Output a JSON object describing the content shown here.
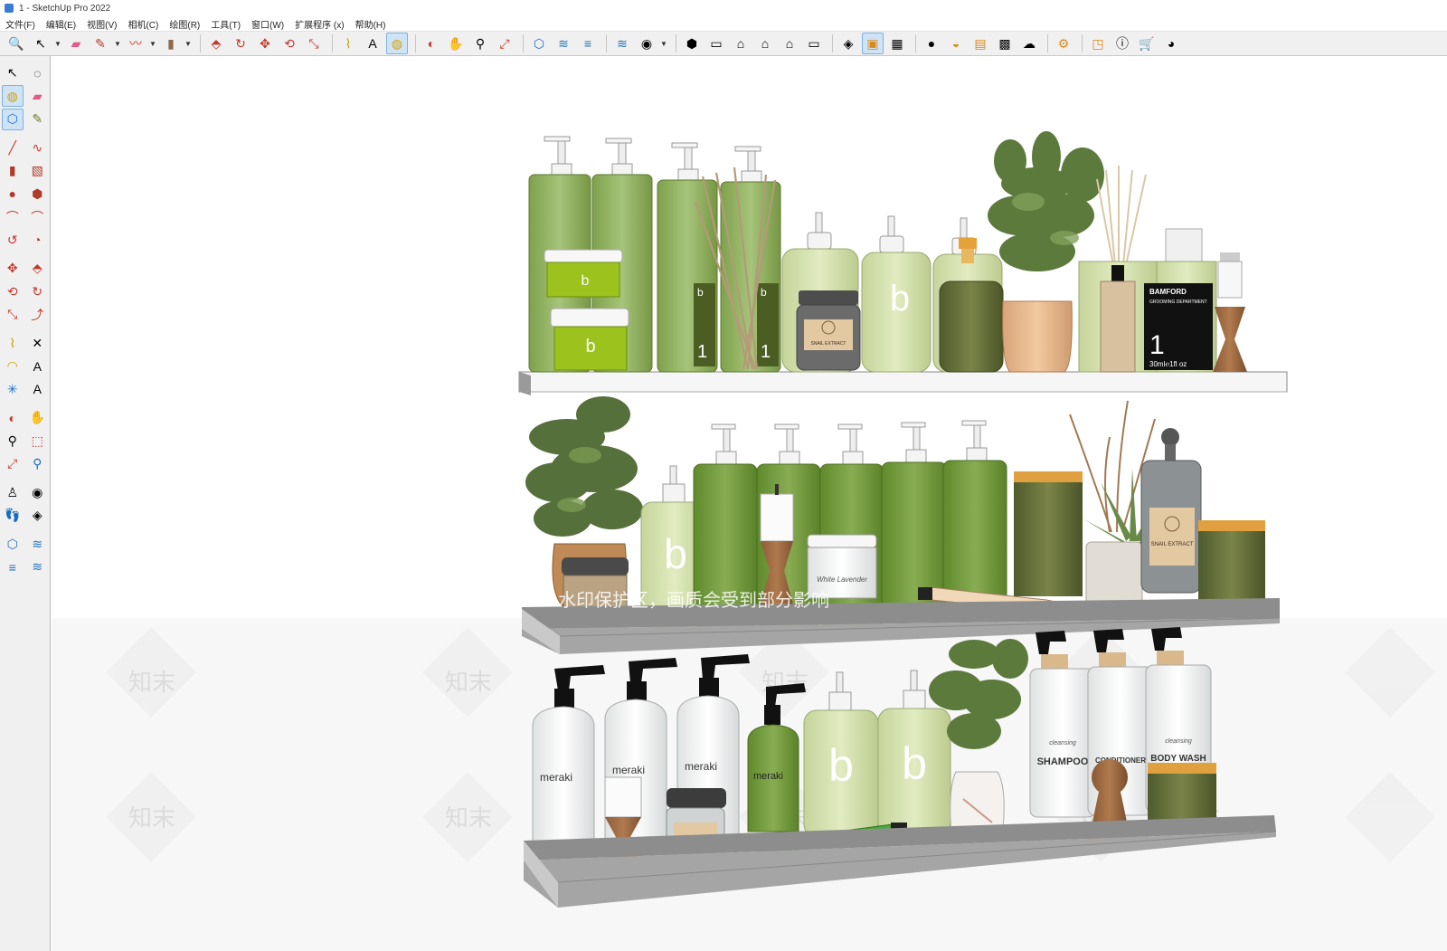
{
  "window": {
    "title": "1 - SketchUp Pro 2022"
  },
  "menu": [
    "文件(F)",
    "编辑(E)",
    "视图(V)",
    "相机(C)",
    "绘图(R)",
    "工具(T)",
    "窗口(W)",
    "扩展程序 (x)",
    "帮助(H)"
  ],
  "toolbar": {
    "groups": [
      [
        {
          "icon": "zoom-icon",
          "glyph": "🔍"
        },
        {
          "icon": "select-icon",
          "glyph": "↖",
          "drop": true
        },
        {
          "icon": "eraser-icon",
          "glyph": "▰",
          "color": "#e05a8a"
        },
        {
          "icon": "pencil-line-icon",
          "glyph": "✎",
          "color": "#c0392b",
          "drop": true
        },
        {
          "icon": "freehand-icon",
          "glyph": "〰",
          "color": "#c0392b",
          "drop": true
        },
        {
          "icon": "rectangle-icon",
          "glyph": "▮",
          "color": "#8b6a4a",
          "drop": true
        }
      ],
      [
        {
          "icon": "push-pull-icon",
          "glyph": "⬘",
          "color": "#c0392b"
        },
        {
          "icon": "follow-me-icon",
          "glyph": "↻",
          "color": "#c0392b"
        },
        {
          "icon": "move-icon",
          "glyph": "✥",
          "color": "#c0392b"
        },
        {
          "icon": "rotate-icon",
          "glyph": "⟲",
          "color": "#c0392b"
        },
        {
          "icon": "scale-icon",
          "glyph": "⤡",
          "color": "#c0392b"
        }
      ],
      [
        {
          "icon": "tape-measure-icon",
          "glyph": "⌇",
          "color": "#c8a000"
        },
        {
          "icon": "text-icon",
          "glyph": "A"
        },
        {
          "icon": "paint-bucket-icon",
          "glyph": "◍",
          "color": "#d4a200",
          "active": true
        }
      ],
      [
        {
          "icon": "orbit-icon",
          "glyph": "◐",
          "color": "#c0392b"
        },
        {
          "icon": "pan-icon",
          "glyph": "✋",
          "color": "#c8a000"
        },
        {
          "icon": "zoom-tool-icon",
          "glyph": "⚲"
        },
        {
          "icon": "zoom-extents-icon",
          "glyph": "⤢",
          "color": "#c0392b"
        }
      ],
      [
        {
          "icon": "warehouse-icon",
          "glyph": "⬡",
          "color": "#1e6fbf"
        },
        {
          "icon": "extension-warehouse-icon",
          "glyph": "≋",
          "color": "#1e6fbf"
        },
        {
          "icon": "layout-icon",
          "glyph": "≡",
          "color": "#1e6fbf"
        }
      ],
      [
        {
          "icon": "styles-icon",
          "glyph": "≋",
          "color": "#1e6fbf"
        },
        {
          "icon": "user-account-icon",
          "glyph": "◉",
          "drop": true
        }
      ],
      [
        {
          "icon": "iso-view-icon",
          "glyph": "⬢"
        },
        {
          "icon": "top-view-icon",
          "glyph": "▭"
        },
        {
          "icon": "front-view-icon",
          "glyph": "⌂"
        },
        {
          "icon": "right-view-icon",
          "glyph": "⌂"
        },
        {
          "icon": "back-view-icon",
          "glyph": "⌂"
        },
        {
          "icon": "left-view-icon",
          "glyph": "▭"
        }
      ],
      [
        {
          "icon": "section-plane-icon",
          "glyph": "◈"
        },
        {
          "icon": "section-display-icon",
          "glyph": "▣",
          "color": "#d88a1a",
          "active": true
        },
        {
          "icon": "section-cuts-icon",
          "glyph": "▦"
        }
      ],
      [
        {
          "icon": "solid-union-icon",
          "glyph": "●"
        },
        {
          "icon": "shadow-icon",
          "glyph": "◒",
          "color": "#d88a1a"
        },
        {
          "icon": "fog-icon",
          "glyph": "▤",
          "color": "#d88a1a"
        },
        {
          "icon": "texture-icon",
          "glyph": "▩"
        },
        {
          "icon": "cloud-icon",
          "glyph": "☁"
        }
      ],
      [
        {
          "icon": "settings-icon",
          "glyph": "⚙",
          "color": "#d88a1a"
        }
      ],
      [
        {
          "icon": "scenes-icon",
          "glyph": "◳",
          "color": "#d88a1a"
        },
        {
          "icon": "info-icon",
          "glyph": "ⓘ"
        },
        {
          "icon": "cart-icon",
          "glyph": "🛒"
        },
        {
          "icon": "profile-icon",
          "glyph": "◕"
        }
      ]
    ]
  },
  "sidebar": {
    "rows": [
      [
        {
          "icon": "select-tool-icon",
          "glyph": "↖"
        },
        {
          "icon": "lasso-icon",
          "glyph": "◌"
        }
      ],
      [
        {
          "icon": "paint-tool-icon",
          "glyph": "◍",
          "color": "#d4a200",
          "active": true
        },
        {
          "icon": "eraser-tool-icon",
          "glyph": "▰",
          "color": "#e05a8a"
        }
      ],
      [
        {
          "icon": "make-component-icon",
          "glyph": "⬡",
          "color": "#1e6fbf",
          "active": true
        },
        {
          "icon": "tag-tool-icon",
          "glyph": "✎",
          "color": "#6a7a30"
        }
      ],
      "gap",
      [
        {
          "icon": "line-tool-icon",
          "glyph": "╱",
          "color": "#c0392b"
        },
        {
          "icon": "freehand-tool-icon",
          "glyph": "∿",
          "color": "#c0392b"
        }
      ],
      [
        {
          "icon": "rectangle-tool-icon",
          "glyph": "▮",
          "color": "#b0392b"
        },
        {
          "icon": "rotated-rect-icon",
          "glyph": "▧",
          "color": "#b0392b"
        }
      ],
      [
        {
          "icon": "circle-tool-icon",
          "glyph": "●",
          "color": "#b0392b"
        },
        {
          "icon": "polygon-tool-icon",
          "glyph": "⬢",
          "color": "#b0392b"
        }
      ],
      [
        {
          "icon": "arc-tool-icon",
          "glyph": "⌒",
          "color": "#c0392b"
        },
        {
          "icon": "two-point-arc-icon",
          "glyph": "⌒",
          "color": "#c0392b"
        }
      ],
      [
        {
          "icon": "three-point-arc-icon",
          "glyph": "↺",
          "color": "#c0392b"
        },
        {
          "icon": "pie-tool-icon",
          "glyph": "◔",
          "color": "#b0392b"
        }
      ],
      "gap",
      [
        {
          "icon": "move-tool-icon",
          "glyph": "✥",
          "color": "#c0392b"
        },
        {
          "icon": "push-pull-tool-icon",
          "glyph": "⬘",
          "color": "#c0392b"
        }
      ],
      [
        {
          "icon": "rotate-tool-icon",
          "glyph": "⟲",
          "color": "#c0392b"
        },
        {
          "icon": "follow-me-tool-icon",
          "glyph": "↻",
          "color": "#c0392b"
        }
      ],
      [
        {
          "icon": "scale-tool-icon",
          "glyph": "⤡",
          "color": "#c0392b"
        },
        {
          "icon": "offset-tool-icon",
          "glyph": "⤴",
          "color": "#c0392b"
        }
      ],
      "gap",
      [
        {
          "icon": "tape-tool-icon",
          "glyph": "⌇",
          "color": "#c8a000"
        },
        {
          "icon": "dimension-tool-icon",
          "glyph": "✕"
        }
      ],
      [
        {
          "icon": "protractor-tool-icon",
          "glyph": "◠",
          "color": "#c8a000"
        },
        {
          "icon": "text-tool-icon",
          "glyph": "A"
        }
      ],
      [
        {
          "icon": "axes-tool-icon",
          "glyph": "✳",
          "color": "#1e6fbf"
        },
        {
          "icon": "3d-text-icon",
          "glyph": "A"
        }
      ],
      "gap",
      [
        {
          "icon": "orbit-tool-icon",
          "glyph": "◐",
          "color": "#c0392b"
        },
        {
          "icon": "pan-tool-icon",
          "glyph": "✋",
          "color": "#c8a000"
        }
      ],
      [
        {
          "icon": "zoom-tool-side-icon",
          "glyph": "⚲"
        },
        {
          "icon": "zoom-window-icon",
          "glyph": "⬚",
          "color": "#c0392b"
        }
      ],
      [
        {
          "icon": "zoom-extents-side-icon",
          "glyph": "⤢",
          "color": "#c0392b"
        },
        {
          "icon": "previous-view-icon",
          "glyph": "⚲",
          "color": "#1e6fbf"
        }
      ],
      "gap",
      [
        {
          "icon": "position-camera-icon",
          "glyph": "♙"
        },
        {
          "icon": "look-around-icon",
          "glyph": "◉"
        }
      ],
      [
        {
          "icon": "walk-icon",
          "glyph": "👣"
        },
        {
          "icon": "section-plane-tool-icon",
          "glyph": "◈"
        }
      ],
      "gap",
      [
        {
          "icon": "warehouse-side-icon",
          "glyph": "⬡",
          "color": "#1e6fbf"
        },
        {
          "icon": "extension-side-icon",
          "glyph": "≋",
          "color": "#1e6fbf"
        }
      ],
      [
        {
          "icon": "layout-side-icon",
          "glyph": "≡",
          "color": "#1e6fbf"
        },
        {
          "icon": "styles-side-icon",
          "glyph": "≋",
          "color": "#1e6fbf"
        }
      ]
    ]
  },
  "scene": {
    "watermark_banner": "水印保护区，画质会受到部分影响",
    "watermark_text": "知末",
    "labels": {
      "b": "b",
      "one": "1",
      "snail": "SNAIL EXTRACT",
      "bamford": "BAMFORD",
      "bamford_sub": "GROOMING DEPARTMENT",
      "bamford_size": "30ml℮1fl oz",
      "meraki": "meraki",
      "white_lavender": "White Lavender",
      "shampoo": "SHAMPOO",
      "conditioner": "CONDITIONER",
      "body_wash": "BODY WASH",
      "cleansing": "cleansing"
    }
  }
}
